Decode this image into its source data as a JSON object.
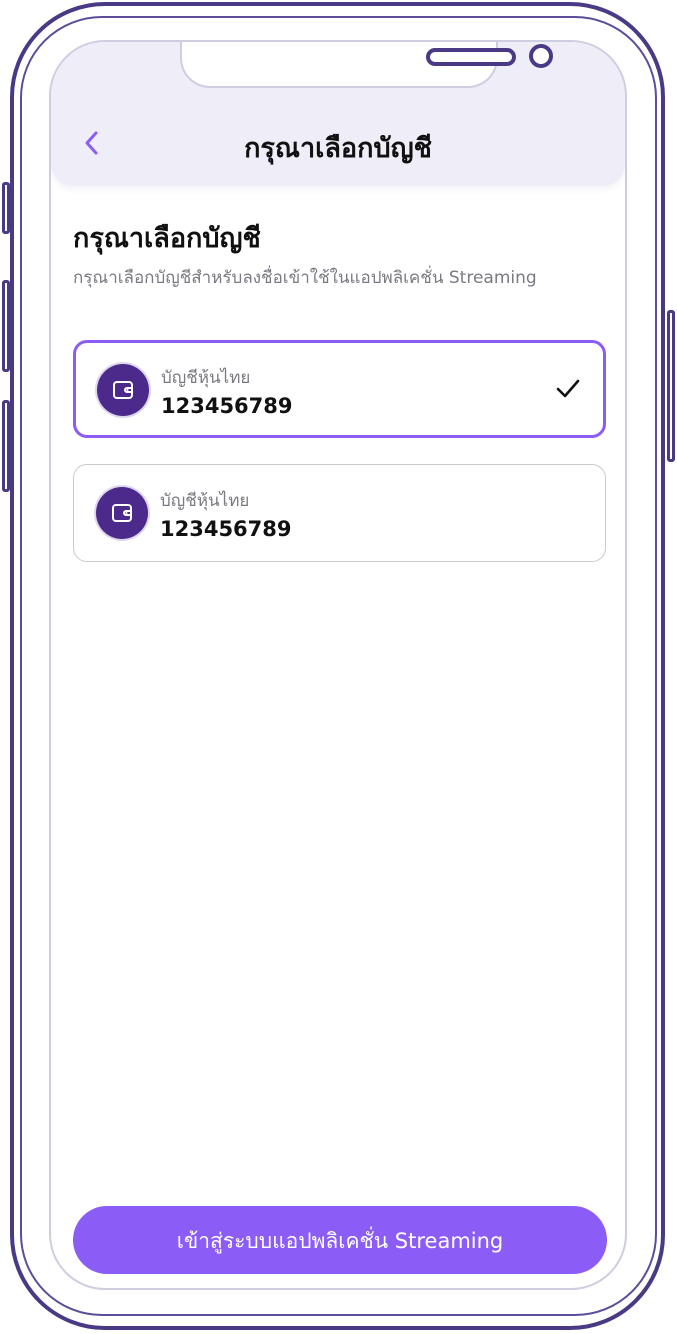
{
  "header": {
    "title": "กรุณาเลือกบัญชี"
  },
  "main": {
    "title": "กรุณาเลือกบัญชี",
    "subtitle": "กรุณาเลือกบัญชีสำหรับลงชื่อเข้าใช้ในแอปพลิเคชั่น Streaming"
  },
  "accounts": [
    {
      "type": "บัญชีหุ้นไทย",
      "number": "123456789",
      "selected": true,
      "icon": "wallet-icon"
    },
    {
      "type": "บัญชีหุ้นไทย",
      "number": "123456789",
      "selected": false,
      "icon": "wallet-icon"
    }
  ],
  "cta": {
    "label": "เข้าสู่ระบบแอปพลิเคชั่น Streaming"
  },
  "colors": {
    "accent": "#8b5cf6",
    "avatar": "#4b2a8c",
    "header_bg": "#efedf8",
    "frame": "#4a3a85"
  }
}
